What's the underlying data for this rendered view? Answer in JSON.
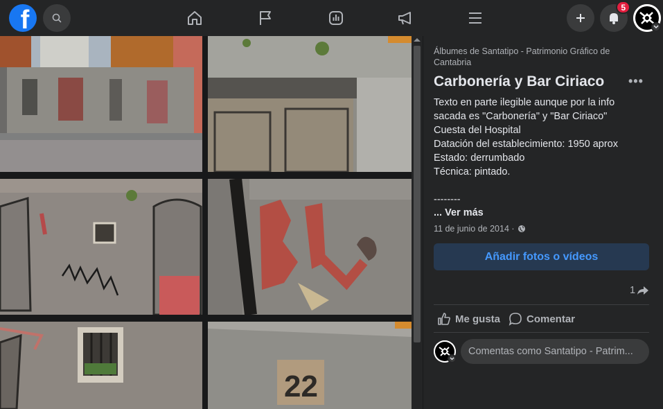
{
  "topbar": {
    "logo_letter": "f",
    "notifications_count": "5",
    "icons": [
      "facebook-logo",
      "search-icon",
      "home-icon",
      "flag-icon",
      "chart-icon",
      "megaphone-icon",
      "menu-icon",
      "plus-icon",
      "bell-icon",
      "profile-avatar"
    ]
  },
  "photos": [
    {
      "name": "photo-street-facade"
    },
    {
      "name": "photo-door-closeup"
    },
    {
      "name": "photo-wall-graffiti"
    },
    {
      "name": "photo-painted-letters"
    },
    {
      "name": "photo-window-wall"
    },
    {
      "name": "photo-number-22",
      "label": "22"
    }
  ],
  "post": {
    "album": "Álbumes de Santatipo - Patrimonio Gráfico de Cantabria",
    "title": "Carbonería y Bar Ciriaco",
    "description_lines": [
      "Texto en parte ilegible aunque por la info",
      "sacada es \"Carbonería\" y \"Bar Ciriaco\"",
      "Cuesta del Hospital",
      "Datación del establecimiento: 1950 aprox",
      "Estado: derrumbado",
      "Técnica: pintado.",
      "",
      "--------"
    ],
    "see_more": "... Ver más",
    "date": "11 de junio de 2014 ·",
    "add_button": "Añadir fotos o vídeos",
    "share_count": "1",
    "like_label": "Me gusta",
    "comment_label": "Comentar",
    "comment_placeholder": "Comentas como Santatipo - Patrim..."
  },
  "colors": {
    "topbar": "#242526",
    "page": "#18191a",
    "accent": "#1877f2",
    "badge": "#e41e3f",
    "button_bg": "#263951",
    "button_text": "#4599ff"
  }
}
